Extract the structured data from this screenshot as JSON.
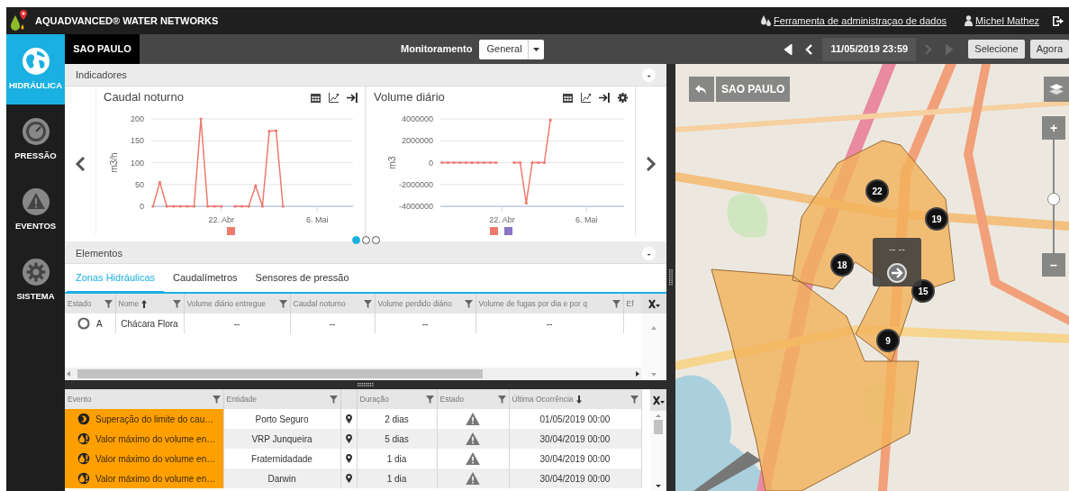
{
  "app": {
    "title": "AQUADVANCED® WATER NETWORKS",
    "admin_link": "Ferramenta de administraçao de dados",
    "user": "Michel Mathez"
  },
  "sidebar": {
    "items": [
      {
        "kind": "globe",
        "label": "HIDRÁULICA",
        "selected": true
      },
      {
        "kind": "gauge",
        "label": "PRESSÃO",
        "selected": false
      },
      {
        "kind": "warning",
        "label": "EVENTOS",
        "selected": false
      },
      {
        "kind": "gear",
        "label": "SISTEMA",
        "selected": false
      }
    ]
  },
  "toolbar": {
    "location_tab": "SAO PAULO",
    "monitoring_label": "Monitoramento",
    "monitoring_value": "General",
    "datetime": "11/05/2019 23:59",
    "time_nav": [
      {
        "kind": "first",
        "disabled": false
      },
      {
        "kind": "prev",
        "disabled": false
      },
      {
        "kind": "next",
        "disabled": true
      },
      {
        "kind": "last",
        "disabled": true
      }
    ],
    "buttons": [
      "Selecione",
      "Agora"
    ]
  },
  "indicators": {
    "title": "Indicadores",
    "collapse": "-",
    "pages": [
      {
        "selected": true
      },
      {
        "selected": false
      },
      {
        "selected": false
      }
    ],
    "charts": [
      {
        "title": "Caudal noturno",
        "settings": false,
        "chart_data": {
          "type": "line",
          "ylabel": "m3/h",
          "categories": [
            null,
            null,
            null,
            null,
            null,
            null,
            null,
            null,
            null,
            null,
            "22. Abr",
            null,
            null,
            null,
            null,
            null,
            null,
            null,
            null,
            null,
            null,
            null,
            null,
            null,
            "6. Mai",
            null,
            null,
            null,
            null,
            null
          ],
          "series": [
            {
              "color": "#ee7a6e",
              "values": [
                0,
                55,
                0,
                0,
                0,
                0,
                0,
                200,
                0,
                0,
                0,
                null,
                0,
                0,
                0,
                47,
                0,
                172,
                173,
                0,
                null,
                null,
                null,
                null,
                null,
                null,
                null,
                null,
                null,
                null
              ]
            }
          ],
          "grid": true,
          "ylim": [
            0,
            200
          ],
          "yticks": [
            0,
            50,
            100,
            150,
            200
          ]
        }
      },
      {
        "title": "Volume diário",
        "settings": true,
        "chart_data": {
          "type": "line",
          "ylabel": "m3",
          "categories": [
            null,
            null,
            null,
            null,
            null,
            null,
            null,
            null,
            null,
            null,
            "22. Abr",
            null,
            null,
            null,
            null,
            null,
            null,
            null,
            null,
            null,
            null,
            null,
            null,
            null,
            "6. Mai",
            null,
            null,
            null,
            null,
            null,
            null
          ],
          "series": [
            {
              "color": "#ee7a6e",
              "values": [
                0,
                0,
                0,
                0,
                0,
                0,
                0,
                0,
                0,
                0,
                null,
                null,
                0,
                0,
                -3700000,
                0,
                0,
                0,
                3900000,
                null,
                null,
                null,
                null,
                null,
                null,
                null,
                null,
                null,
                null,
                null,
                null
              ]
            },
            {
              "color": "#8775c6",
              "values": [
                null,
                null,
                null,
                null,
                null,
                null,
                null,
                null,
                null,
                null,
                null,
                null,
                null,
                null,
                null,
                null,
                null,
                null,
                null,
                null,
                null,
                null,
                null,
                null,
                null,
                null,
                null,
                null,
                null,
                null,
                null
              ]
            }
          ],
          "grid": true,
          "ylim": [
            -4000000,
            4000000
          ],
          "yticks": [
            -4000000,
            -2000000,
            0,
            2000000,
            4000000
          ]
        }
      }
    ]
  },
  "elements": {
    "title": "Elementos",
    "collapse": "-",
    "tabs": [
      {
        "label": "Zonas Hidráulicas",
        "selected": true
      },
      {
        "label": "Caudalímetros",
        "selected": false
      },
      {
        "label": "Sensores de pressão",
        "selected": false
      }
    ],
    "columns": [
      {
        "label": "Estado",
        "sorted": false
      },
      {
        "label": "Nome",
        "sorted": true,
        "descending": false
      },
      {
        "label": "Volume diário entregue",
        "sorted": false
      },
      {
        "label": "Caudal noturno",
        "sorted": false
      },
      {
        "label": "Volume perdido diário",
        "sorted": false
      },
      {
        "label": "Volume de fugas por dia e por q",
        "sorted": false
      },
      {
        "label": "Ef",
        "sorted": false
      }
    ],
    "rows": [
      {
        "cells": [
          "A",
          "Chácara Flora",
          "--",
          "--",
          "--",
          "--"
        ]
      }
    ]
  },
  "events": {
    "columns": [
      {
        "kind": "text",
        "label": "Evento",
        "sorted": false
      },
      {
        "kind": "text",
        "label": "Entidade",
        "sorted": false
      },
      {
        "kind": "pin"
      },
      {
        "kind": "text",
        "label": "Duração",
        "sorted": false
      },
      {
        "kind": "text",
        "label": "Estado",
        "sorted": false
      },
      {
        "kind": "text",
        "label": "Última Ocorrência",
        "sorted": true,
        "descending": true
      }
    ],
    "rows": [
      {
        "kind": "flow",
        "event": "Superação do limite do cau…",
        "entity": "Porto Seguro",
        "duration": "2 dias",
        "date": "01/05/2019 00:00"
      },
      {
        "kind": "drop",
        "event": "Valor máximo do volume en…",
        "entity": "VRP Junqueira",
        "duration": "5 dias",
        "date": "30/04/2019 00:00"
      },
      {
        "kind": "drop",
        "event": "Valor máximo do volume en…",
        "entity": "Fraternidadade",
        "duration": "1 dia",
        "date": "30/04/2019 00:00"
      },
      {
        "kind": "drop",
        "event": "Valor máximo do volume en…",
        "entity": "Darwin",
        "duration": "1 dia",
        "date": "30/04/2019 00:00"
      }
    ]
  },
  "map": {
    "back_label": "SAO PAULO",
    "clusters": [
      "22",
      "19",
      "18",
      "15",
      "9"
    ],
    "popup": "-- --",
    "zoom": {
      "plus": "+",
      "minus": "–",
      "level": 0.47
    }
  }
}
